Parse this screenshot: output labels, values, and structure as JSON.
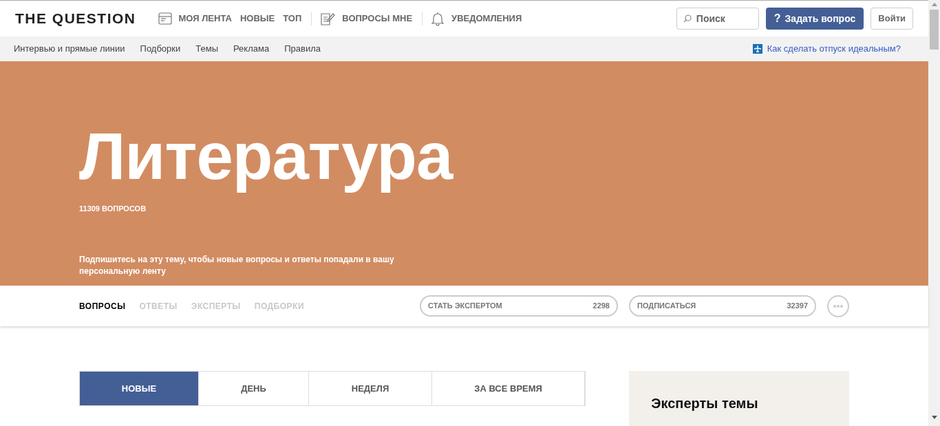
{
  "header": {
    "logo": "THE QUESTION",
    "nav": [
      {
        "label": "МОЯ ЛЕНТА",
        "kind": "feed"
      },
      {
        "label": "НОВЫЕ",
        "kind": "plain"
      },
      {
        "label": "ТОП",
        "kind": "plain"
      },
      {
        "label": "ВОПРОСЫ МНЕ",
        "kind": "mine"
      },
      {
        "label": "УВЕДОМЛЕНИЯ",
        "kind": "alerts"
      }
    ],
    "search": {
      "placeholder": "Поиск"
    },
    "ask_button": {
      "icon": "?",
      "label": "Задать вопрос"
    },
    "login_button": "Войти"
  },
  "subnav": {
    "links": [
      "Интервью и прямые линии",
      "Подборки",
      "Темы",
      "Реклама",
      "Правила"
    ],
    "promo": "Как сделать отпуск идеальным?"
  },
  "hero": {
    "title": "Литература",
    "count": "11309 ВОПРОСОВ",
    "subscribe_hint": "Подпишитесь на эту тему, чтобы новые вопросы и ответы попадали в вашу персональную ленту"
  },
  "topic_tabs": [
    {
      "label": "ВОПРОСЫ",
      "selected": true
    },
    {
      "label": "ОТВЕТЫ",
      "selected": false
    },
    {
      "label": "ЭКСПЕРТЫ",
      "selected": false
    },
    {
      "label": "ПОДБОРКИ",
      "selected": false
    }
  ],
  "actions": [
    {
      "label": "СТАТЬ ЭКСПЕРТОМ",
      "count": "2298"
    },
    {
      "label": "ПОДПИСАТЬСЯ",
      "count": "32397"
    }
  ],
  "period_tabs": [
    {
      "label": "НОВЫЕ",
      "selected": true
    },
    {
      "label": "ДЕНЬ",
      "selected": false
    },
    {
      "label": "НЕДЕЛЯ",
      "selected": false
    },
    {
      "label": "ЗА ВСЕ ВРЕМЯ",
      "selected": false
    }
  ],
  "sidebar": {
    "title": "Эксперты темы"
  }
}
